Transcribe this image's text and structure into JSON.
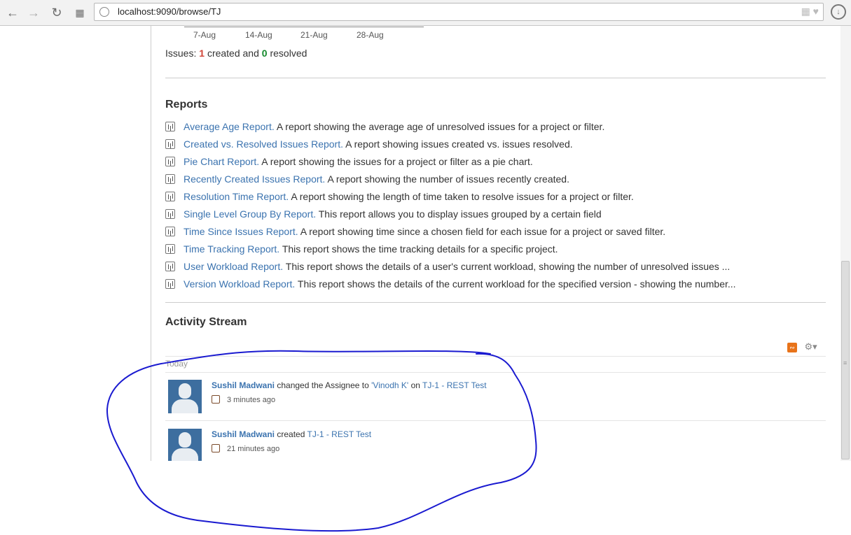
{
  "browser": {
    "url": "localhost:9090/browse/TJ"
  },
  "chart": {
    "ticks": [
      "7-Aug",
      "14-Aug",
      "21-Aug",
      "28-Aug"
    ]
  },
  "summary": {
    "prefix": "Issues:",
    "created_count": "1",
    "created_label": "created and",
    "resolved_count": "0",
    "resolved_label": "resolved"
  },
  "reports": {
    "heading": "Reports",
    "items": [
      {
        "title": "Average Age Report.",
        "description": "A report showing the average age of unresolved issues for a project or filter."
      },
      {
        "title": "Created vs. Resolved Issues Report.",
        "description": "A report showing issues created vs. issues resolved."
      },
      {
        "title": "Pie Chart Report.",
        "description": "A report showing the issues for a project or filter as a pie chart."
      },
      {
        "title": "Recently Created Issues Report.",
        "description": "A report showing the number of issues recently created."
      },
      {
        "title": "Resolution Time Report.",
        "description": "A report showing the length of time taken to resolve issues for a project or filter."
      },
      {
        "title": "Single Level Group By Report.",
        "description": "This report allows you to display issues grouped by a certain field"
      },
      {
        "title": "Time Since Issues Report.",
        "description": "A report showing time since a chosen field for each issue for a project or saved filter."
      },
      {
        "title": "Time Tracking Report.",
        "description": "This report shows the time tracking details for a specific project."
      },
      {
        "title": "User Workload Report.",
        "description": "This report shows the details of a user's current workload, showing the number of unresolved issues ..."
      },
      {
        "title": "Version Workload Report.",
        "description": "This report shows the details of the current workload for the specified version - showing the number..."
      }
    ]
  },
  "activity": {
    "heading": "Activity Stream",
    "day": "Today",
    "items": [
      {
        "user": "Sushil Madwani",
        "action": "changed the Assignee to",
        "target": "'Vinodh K'",
        "on": "on",
        "issue": "TJ-1 - REST Test",
        "time": "3 minutes ago"
      },
      {
        "user": "Sushil Madwani",
        "action": "created",
        "target": "",
        "on": "",
        "issue": "TJ-1 - REST Test",
        "time": "21 minutes ago"
      }
    ]
  },
  "colors": {
    "link": "#3b73af",
    "created": "#d04437",
    "resolved": "#14892c",
    "annotation": "#1a1ad0"
  }
}
